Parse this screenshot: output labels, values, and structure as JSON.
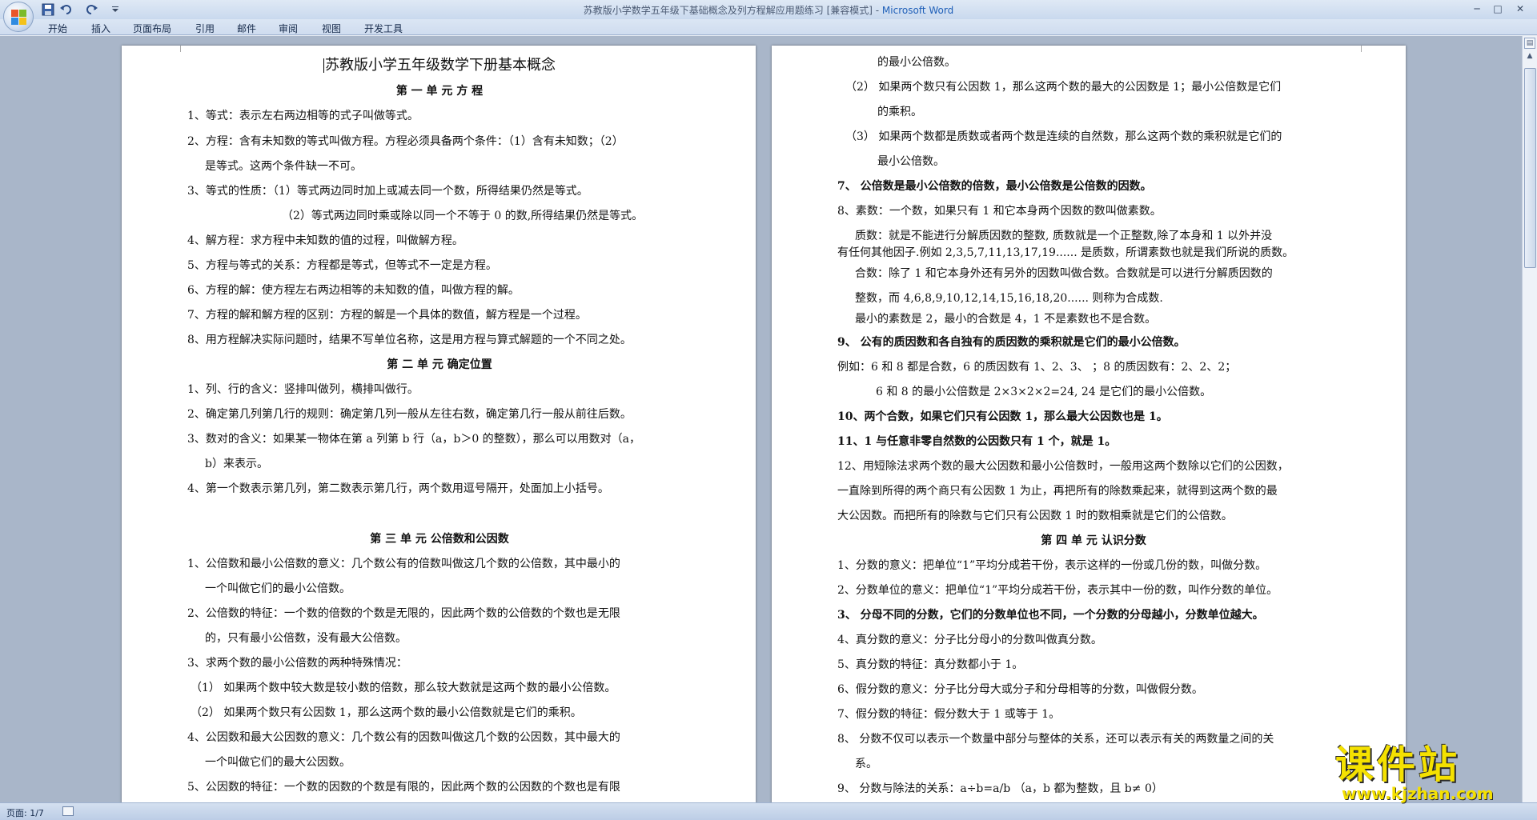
{
  "window": {
    "title": "苏教版小学数学五年级下基础概念及列方程解应用题练习 [兼容模式] - ",
    "app_name": "Microsoft Word",
    "quick_access": [
      "save-icon",
      "undo-icon",
      "redo-icon",
      "customize-icon"
    ],
    "controls": [
      "minimize-icon",
      "maximize-icon",
      "close-icon"
    ]
  },
  "ribbon": {
    "tabs": [
      "开始",
      "插入",
      "页面布局",
      "引用",
      "邮件",
      "审阅",
      "视图",
      "开发工具"
    ]
  },
  "left_page": {
    "title": "苏教版小学五年级数学下册基本概念",
    "lines": [
      "第 一 单 元      方    程",
      "1、等式：表示左右两边相等的式子叫做等式。",
      "2、方程：含有未知数的等式叫做方程。方程必须具备两个条件：（1）含有未知数；（2）",
      "是等式。这两个条件缺一不可。",
      "3、等式的性质：（1）等式两边同时加上或减去同一个数，所得结果仍然是等式。",
      "（2）等式两边同时乘或除以同一个不等于 0 的数,所得结果仍然是等式。",
      "4、解方程：求方程中未知数的值的过程，叫做解方程。",
      "5、方程与等式的关系：方程都是等式，但等式不一定是方程。",
      "6、方程的解：使方程左右两边相等的未知数的值，叫做方程的解。",
      "7、方程的解和解方程的区别：方程的解是一个具体的数值，解方程是一个过程。",
      "8、用方程解决实际问题时，结果不写单位名称，这是用方程与算式解题的一个不同之处。",
      "第 二 单 元      确定位置",
      "1、列、行的含义：竖排叫做列，横排叫做行。",
      "2、确定第几列第几行的规则：确定第几列一般从左往右数，确定第几行一般从前往后数。",
      "3、数对的含义：如果某一物体在第 a 列第 b 行（a，b＞0 的整数），那么可以用数对（a，",
      "b）来表示。",
      "4、第一个数表示第几列，第二数表示第几行，两个数用逗号隔开，处面加上小括号。",
      "",
      "第 三 单 元      公倍数和公因数",
      "1、公倍数和最小公倍数的意义：几个数公有的倍数叫做这几个数的公倍数，其中最小的",
      "一个叫做它们的最小公倍数。",
      "2、公倍数的特征：一个数的倍数的个数是无限的，因此两个数的公倍数的个数也是无限",
      "的，只有最小公倍数，没有最大公倍数。",
      "3、求两个数的最小公倍数的两种特殊情况：",
      "（1）  如果两个数中较大数是较小数的倍数，那么较大数就是这两个数的最小公倍数。",
      "（2）  如果两个数只有公因数 1，那么这两个数的最小公倍数就是它们的乘积。",
      "4、公因数和最大公因数的意义：几个数公有的因数叫做这几个数的公因数，其中最大的",
      "一个叫做它们的最大公因数。",
      "5、公因数的特征：一个数的因数的个数是有限的，因此两个数的公因数的个数也是有限"
    ]
  },
  "right_page": {
    "lines": [
      "的最小公倍数。",
      "（2）  如果两个数只有公因数 1，那么这两个数的最大的公因数是 1；最小公倍数是它们",
      "的乘积。",
      "（3）  如果两个数都是质数或者两个数是连续的自然数，那么这两个数的乘积就是它们的",
      "最小公倍数。",
      "7、 公倍数是最小公倍数的倍数，最小公倍数是公倍数的因数。",
      "8、素数：一个数，如果只有 1 和它本身两个因数的数叫做素数。",
      "质数：就是不能进行分解质因数的整数, 质数就是一个正整数,除了本身和  1  以外并没",
      "有任何其他因子.例如 2,3,5,7,11,13,17,19...... 是质数，所谓素数也就是我们所说的质数。",
      "合数：除了 1 和它本身外还有另外的因数叫做合数。合数就是可以进行分解质因数的",
      "整数，而  4,6,8,9,10,12,14,15,16,18,20......  则称为合成数.",
      "最小的素数是 2，最小的合数是 4，1 不是素数也不是合数。",
      "9、 公有的质因数和各自独有的质因数的乘积就是它们的最小公倍数。",
      "例如：6 和 8 都是合数，6 的质因数有 1、2、3、    ；8 的质因数有：2、2、2；",
      "6 和 8 的最小公倍数是 2×3×2×2=24,    24 是它们的最小公倍数。",
      "10、两个合数，如果它们只有公因数 1，那么最大公因数也是 1。",
      "11、1 与任意非零自然数的公因数只有 1 个，就是 1。",
      "12、用短除法求两个数的最大公因数和最小公倍数时，一般用这两个数除以它们的公因数，",
      "一直除到所得的两个商只有公因数 1 为止，再把所有的除数乘起来，就得到这两个数的最",
      "大公因数。而把所有的除数与它们只有公因数 1 时的数相乘就是它们的公倍数。",
      "第   四   单   元       认识分数",
      "1、分数的意义：把单位“1”平均分成若干份，表示这样的一份或几份的数，叫做分数。",
      "2、分数单位的意义：把单位“1”平均分成若干份，表示其中一份的数，叫作分数的单位。",
      "3、 分母不同的分数，它们的分数单位也不同，一个分数的分母越小，分数单位越大。",
      "4、真分数的意义：分子比分母小的分数叫做真分数。",
      "5、真分数的特征：真分数都小于 1。",
      "6、假分数的意义：分子比分母大或分子和分母相等的分数，叫做假分数。",
      "7、假分数的特征：假分数大于 1 或等于 1。",
      "8、 分数不仅可以表示一个数量中部分与整体的关系，还可以表示有关的两数量之间的关",
      "系。",
      "9、 分数与除法的关系：a÷b=a/b  （a，b 都为整数，且 b≠  0）"
    ]
  },
  "statusbar": {
    "page_info": "页面: 1/7"
  },
  "watermark": {
    "text": "课件站",
    "url": "www.kjzhan.com"
  }
}
